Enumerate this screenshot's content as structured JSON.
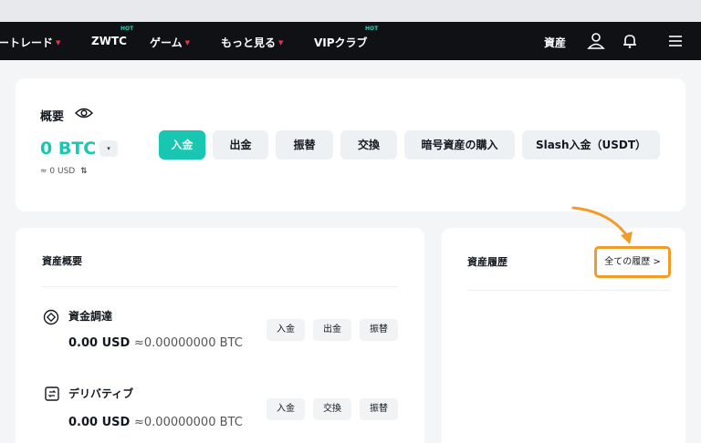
{
  "nav": {
    "items": [
      {
        "label": "ートレード",
        "caret": "▼"
      },
      {
        "label": "ZWTC",
        "badge": "HOT"
      },
      {
        "label": "ゲーム",
        "caret": "▼"
      },
      {
        "label": "もっと見る",
        "caret": "▼"
      },
      {
        "label": "VIPクラブ",
        "badge": "HOT"
      }
    ],
    "assets_label": "資産",
    "icons": [
      "user-icon",
      "bell-icon",
      "menu-icon"
    ]
  },
  "overview": {
    "title": "概要",
    "balance": "0 BTC",
    "dropdown": "▾",
    "approx": "≈ 0 USD",
    "swap_icon": "⇅",
    "actions": [
      "入金",
      "出金",
      "振替",
      "交換",
      "暗号資産の購入",
      "Slash入金（USDT）"
    ]
  },
  "asset_summary": {
    "title": "資産概要",
    "accounts": [
      {
        "name": "資金調達",
        "usd": "0.00 USD",
        "btc": "≈0.00000000 BTC",
        "buttons": [
          "入金",
          "出金",
          "振替"
        ]
      },
      {
        "name": "デリバティブ",
        "usd": "0.00 USD",
        "btc": "≈0.00000000 BTC",
        "buttons": [
          "入金",
          "交換",
          "振替"
        ]
      }
    ]
  },
  "asset_history": {
    "title": "資産履歴",
    "all_history": "全ての履歴 >"
  },
  "colors": {
    "accent": "#18c6b1",
    "highlight": "#f29b26",
    "nav_bg": "#0f1115",
    "caret": "#f0304a"
  }
}
